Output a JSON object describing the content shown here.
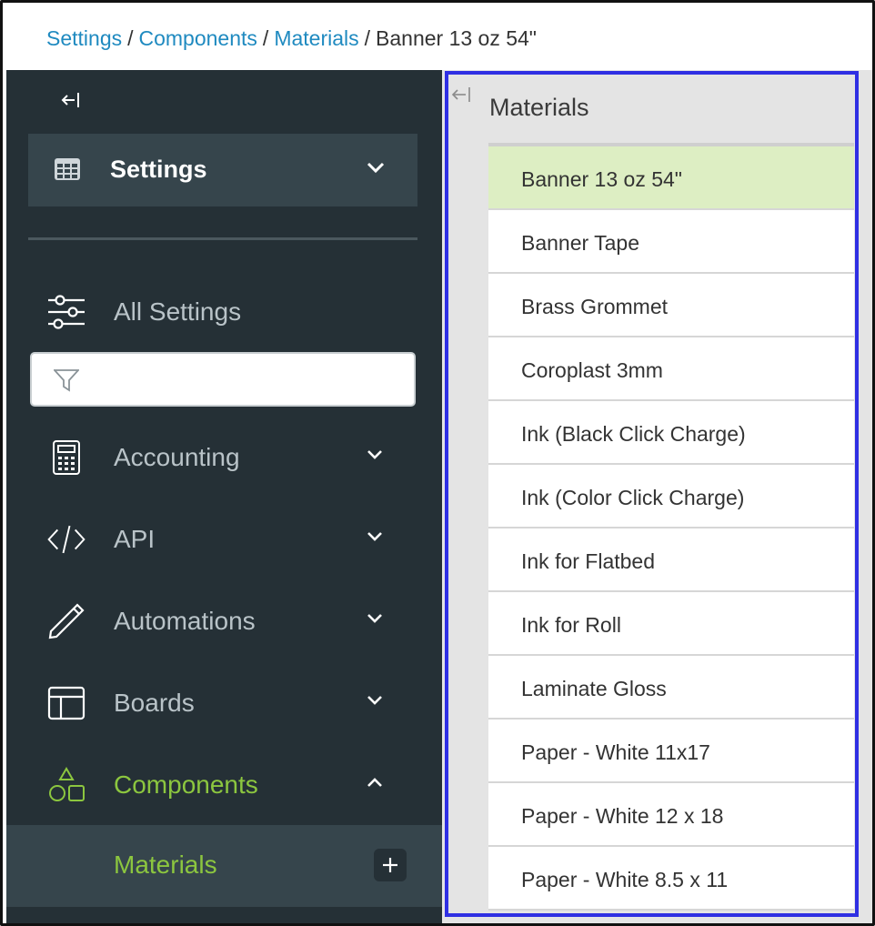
{
  "breadcrumb": {
    "items": [
      "Settings",
      "Components",
      "Materials"
    ],
    "separator": "/",
    "current": "Banner 13 oz 54\""
  },
  "sidebar": {
    "header": {
      "label": "Settings",
      "icon": "grid-icon"
    },
    "all_settings": {
      "label": "All Settings",
      "icon": "sliders-icon"
    },
    "filter": {
      "placeholder": "",
      "icon": "filter-icon"
    },
    "sections": [
      {
        "label": "Accounting",
        "icon": "calculator-icon",
        "expanded": false
      },
      {
        "label": "API",
        "icon": "code-icon",
        "expanded": false
      },
      {
        "label": "Automations",
        "icon": "pen-icon",
        "expanded": false
      },
      {
        "label": "Boards",
        "icon": "layout-icon",
        "expanded": false
      },
      {
        "label": "Components",
        "icon": "shapes-icon",
        "expanded": true
      }
    ],
    "active_sub_item": {
      "label": "Materials",
      "add_icon": "plus-icon"
    }
  },
  "panel": {
    "title": "Materials",
    "items": [
      "Banner 13 oz 54\"",
      "Banner Tape",
      "Brass Grommet",
      "Coroplast 3mm",
      "Ink (Black Click Charge)",
      "Ink (Color Click Charge)",
      "Ink for Flatbed",
      "Ink for Roll",
      "Laminate Gloss",
      "Paper - White 11x17",
      "Paper - White 12 x 18",
      "Paper - White 8.5 x 11"
    ],
    "selected_index": 0
  },
  "colors": {
    "sidebar_bg": "#253036",
    "sidebar_highlight": "#36454c",
    "accent_green": "#8cc63f",
    "link_blue": "#1f8ac0",
    "selected_row": "#ddeec3",
    "outline_blue": "#2f2fe3"
  }
}
